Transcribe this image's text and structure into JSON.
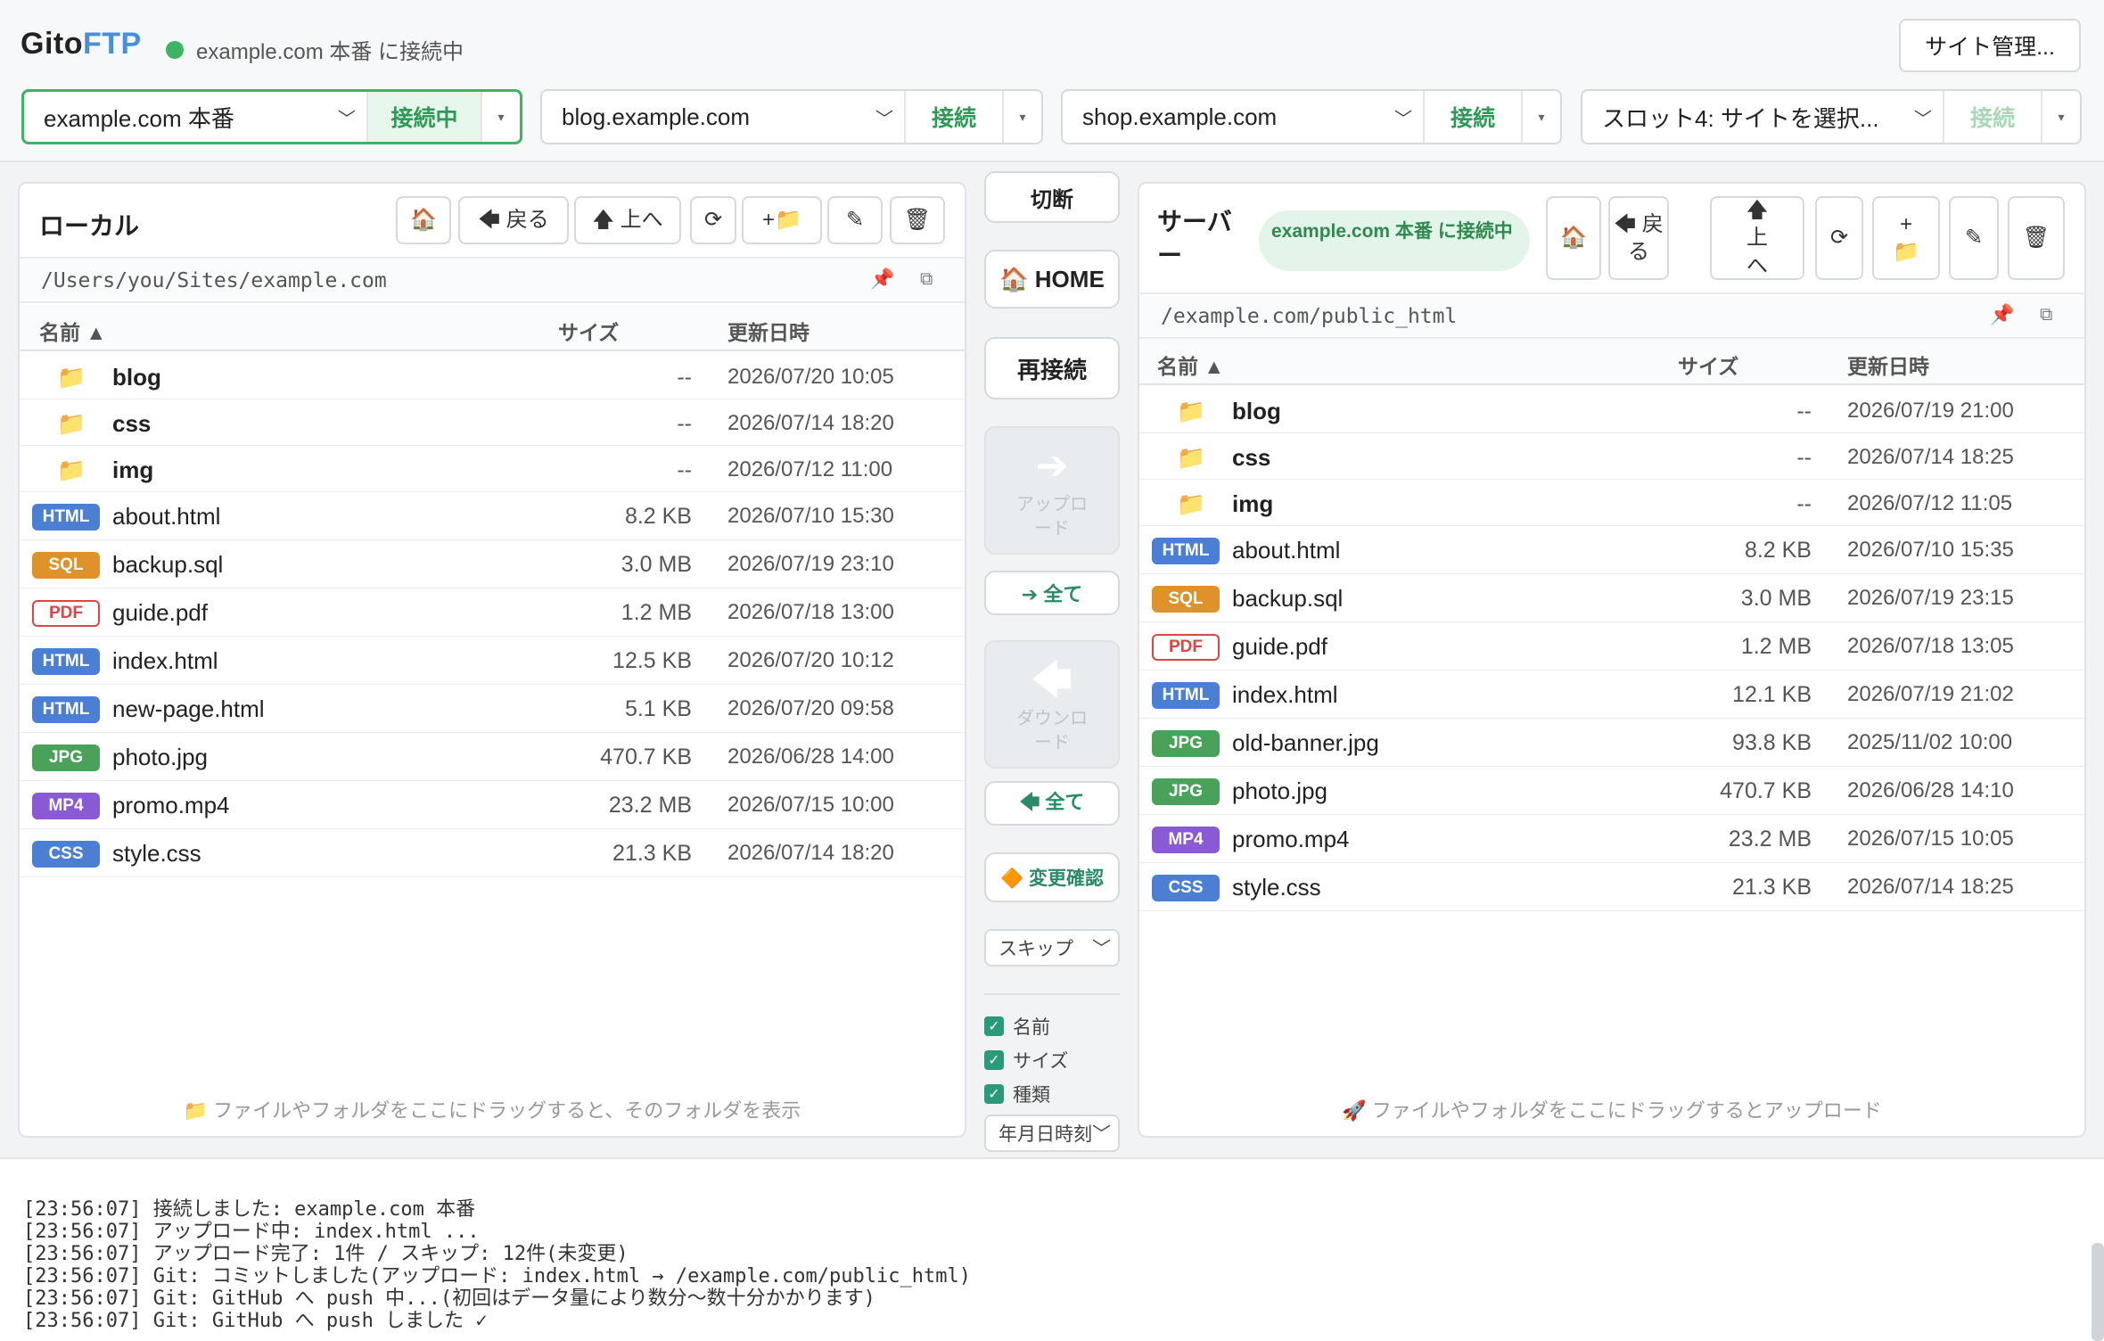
{
  "app": {
    "brand_part1": "Gito",
    "brand_part2": "FTP",
    "status_text": "example.com 本番 に接続中",
    "site_manager_label": "サイト管理..."
  },
  "slots": [
    {
      "site": "example.com 本番",
      "action": "接続中",
      "active": true
    },
    {
      "site": "blog.example.com",
      "action": "接続"
    },
    {
      "site": "shop.example.com",
      "action": "接続"
    },
    {
      "site": "スロット4: サイトを選択...",
      "action": "接続",
      "disabled": true
    }
  ],
  "local": {
    "title": "ローカル",
    "toolbar": {
      "home": "🏠",
      "back": "🡄 戻る",
      "up": "🡅 上へ",
      "refresh": "⟳",
      "newfolder": "+📁",
      "rename": "✎",
      "delete": "🗑"
    },
    "path": "/Users/you/Sites/example.com",
    "columns": {
      "name": "名前 ▲",
      "size": "サイズ",
      "date": "更新日時"
    },
    "rows": [
      {
        "type": "dir",
        "name": "blog",
        "size": "--",
        "date": "2026/07/20 10:05"
      },
      {
        "type": "dir",
        "name": "css",
        "size": "--",
        "date": "2026/07/14 18:20"
      },
      {
        "type": "dir",
        "name": "img",
        "size": "--",
        "date": "2026/07/12 11:00"
      },
      {
        "type": "html",
        "badge": "HTML",
        "name": "about.html",
        "size": "8.2 KB",
        "date": "2026/07/10 15:30"
      },
      {
        "type": "sql",
        "badge": "SQL",
        "name": "backup.sql",
        "size": "3.0 MB",
        "date": "2026/07/19 23:10"
      },
      {
        "type": "pdf",
        "badge": "PDF",
        "name": "guide.pdf",
        "size": "1.2 MB",
        "date": "2026/07/18 13:00"
      },
      {
        "type": "html",
        "badge": "HTML",
        "name": "index.html",
        "size": "12.5 KB",
        "date": "2026/07/20 10:12"
      },
      {
        "type": "html",
        "badge": "HTML",
        "name": "new-page.html",
        "size": "5.1 KB",
        "date": "2026/07/20 09:58"
      },
      {
        "type": "jpg",
        "badge": "JPG",
        "name": "photo.jpg",
        "size": "470.7 KB",
        "date": "2026/06/28 14:00"
      },
      {
        "type": "mp4",
        "badge": "MP4",
        "name": "promo.mp4",
        "size": "23.2 MB",
        "date": "2026/07/15 10:00"
      },
      {
        "type": "css",
        "badge": "CSS",
        "name": "style.css",
        "size": "21.3 KB",
        "date": "2026/07/14 18:20"
      }
    ],
    "drop_hint": "📁 ファイルやフォルダをここにドラッグすると、そのフォルダを表示"
  },
  "server": {
    "title": "サーバー",
    "badge": "example.com 本番 に接続中",
    "toolbar": {
      "home": "🏠",
      "back": "🡄 戻る",
      "up": "🡅 上へ",
      "refresh": "⟳",
      "newfolder": "+ 📁",
      "rename": "✎",
      "delete": "🗑"
    },
    "path": "/example.com/public_html",
    "columns": {
      "name": "名前 ▲",
      "size": "サイズ",
      "date": "更新日時"
    },
    "rows": [
      {
        "type": "dir",
        "name": "blog",
        "size": "--",
        "date": "2026/07/19 21:00"
      },
      {
        "type": "dir",
        "name": "css",
        "size": "--",
        "date": "2026/07/14 18:25"
      },
      {
        "type": "dir",
        "name": "img",
        "size": "--",
        "date": "2026/07/12 11:05"
      },
      {
        "type": "html",
        "badge": "HTML",
        "name": "about.html",
        "size": "8.2 KB",
        "date": "2026/07/10 15:35"
      },
      {
        "type": "sql",
        "badge": "SQL",
        "name": "backup.sql",
        "size": "3.0 MB",
        "date": "2026/07/19 23:15"
      },
      {
        "type": "pdf",
        "badge": "PDF",
        "name": "guide.pdf",
        "size": "1.2 MB",
        "date": "2026/07/18 13:05"
      },
      {
        "type": "html",
        "badge": "HTML",
        "name": "index.html",
        "size": "12.1 KB",
        "date": "2026/07/19 21:02"
      },
      {
        "type": "jpg",
        "badge": "JPG",
        "name": "old-banner.jpg",
        "size": "93.8 KB",
        "date": "2025/11/02 10:00"
      },
      {
        "type": "jpg",
        "badge": "JPG",
        "name": "photo.jpg",
        "size": "470.7 KB",
        "date": "2026/06/28 14:10"
      },
      {
        "type": "mp4",
        "badge": "MP4",
        "name": "promo.mp4",
        "size": "23.2 MB",
        "date": "2026/07/15 10:05"
      },
      {
        "type": "css",
        "badge": "CSS",
        "name": "style.css",
        "size": "21.3 KB",
        "date": "2026/07/14 18:25"
      }
    ],
    "drop_hint": "🚀 ファイルやフォルダをここにドラッグするとアップロード"
  },
  "middle": {
    "disconnect": "切断",
    "home": "🏠 HOME",
    "reconnect": "再接続",
    "upload_arrow": "➔",
    "upload_label": "アップロード",
    "upload_all": "➔ 全て",
    "download_arrow": "🡄",
    "download_label": "ダウンロード",
    "download_all": "🡄 全て",
    "diff": "🔶 変更確認",
    "skip_select": "スキップ",
    "check_name": "名前",
    "check_size": "サイズ",
    "check_kind": "種類",
    "date_select": "年月日時刻"
  },
  "log": [
    "[23:56:07] 接続しました: example.com 本番",
    "[23:56:07] アップロード中: index.html ...",
    "[23:56:07] アップロード完了: 1件 / スキップ: 12件(未変更)",
    "[23:56:07] Git: コミットしました(アップロード: index.html → /example.com/public_html)",
    "[23:56:07] Git: GitHub へ push 中...(初回はデータ量により数分〜数十分かかります)",
    "[23:56:07] Git: GitHub へ push しました ✓"
  ]
}
